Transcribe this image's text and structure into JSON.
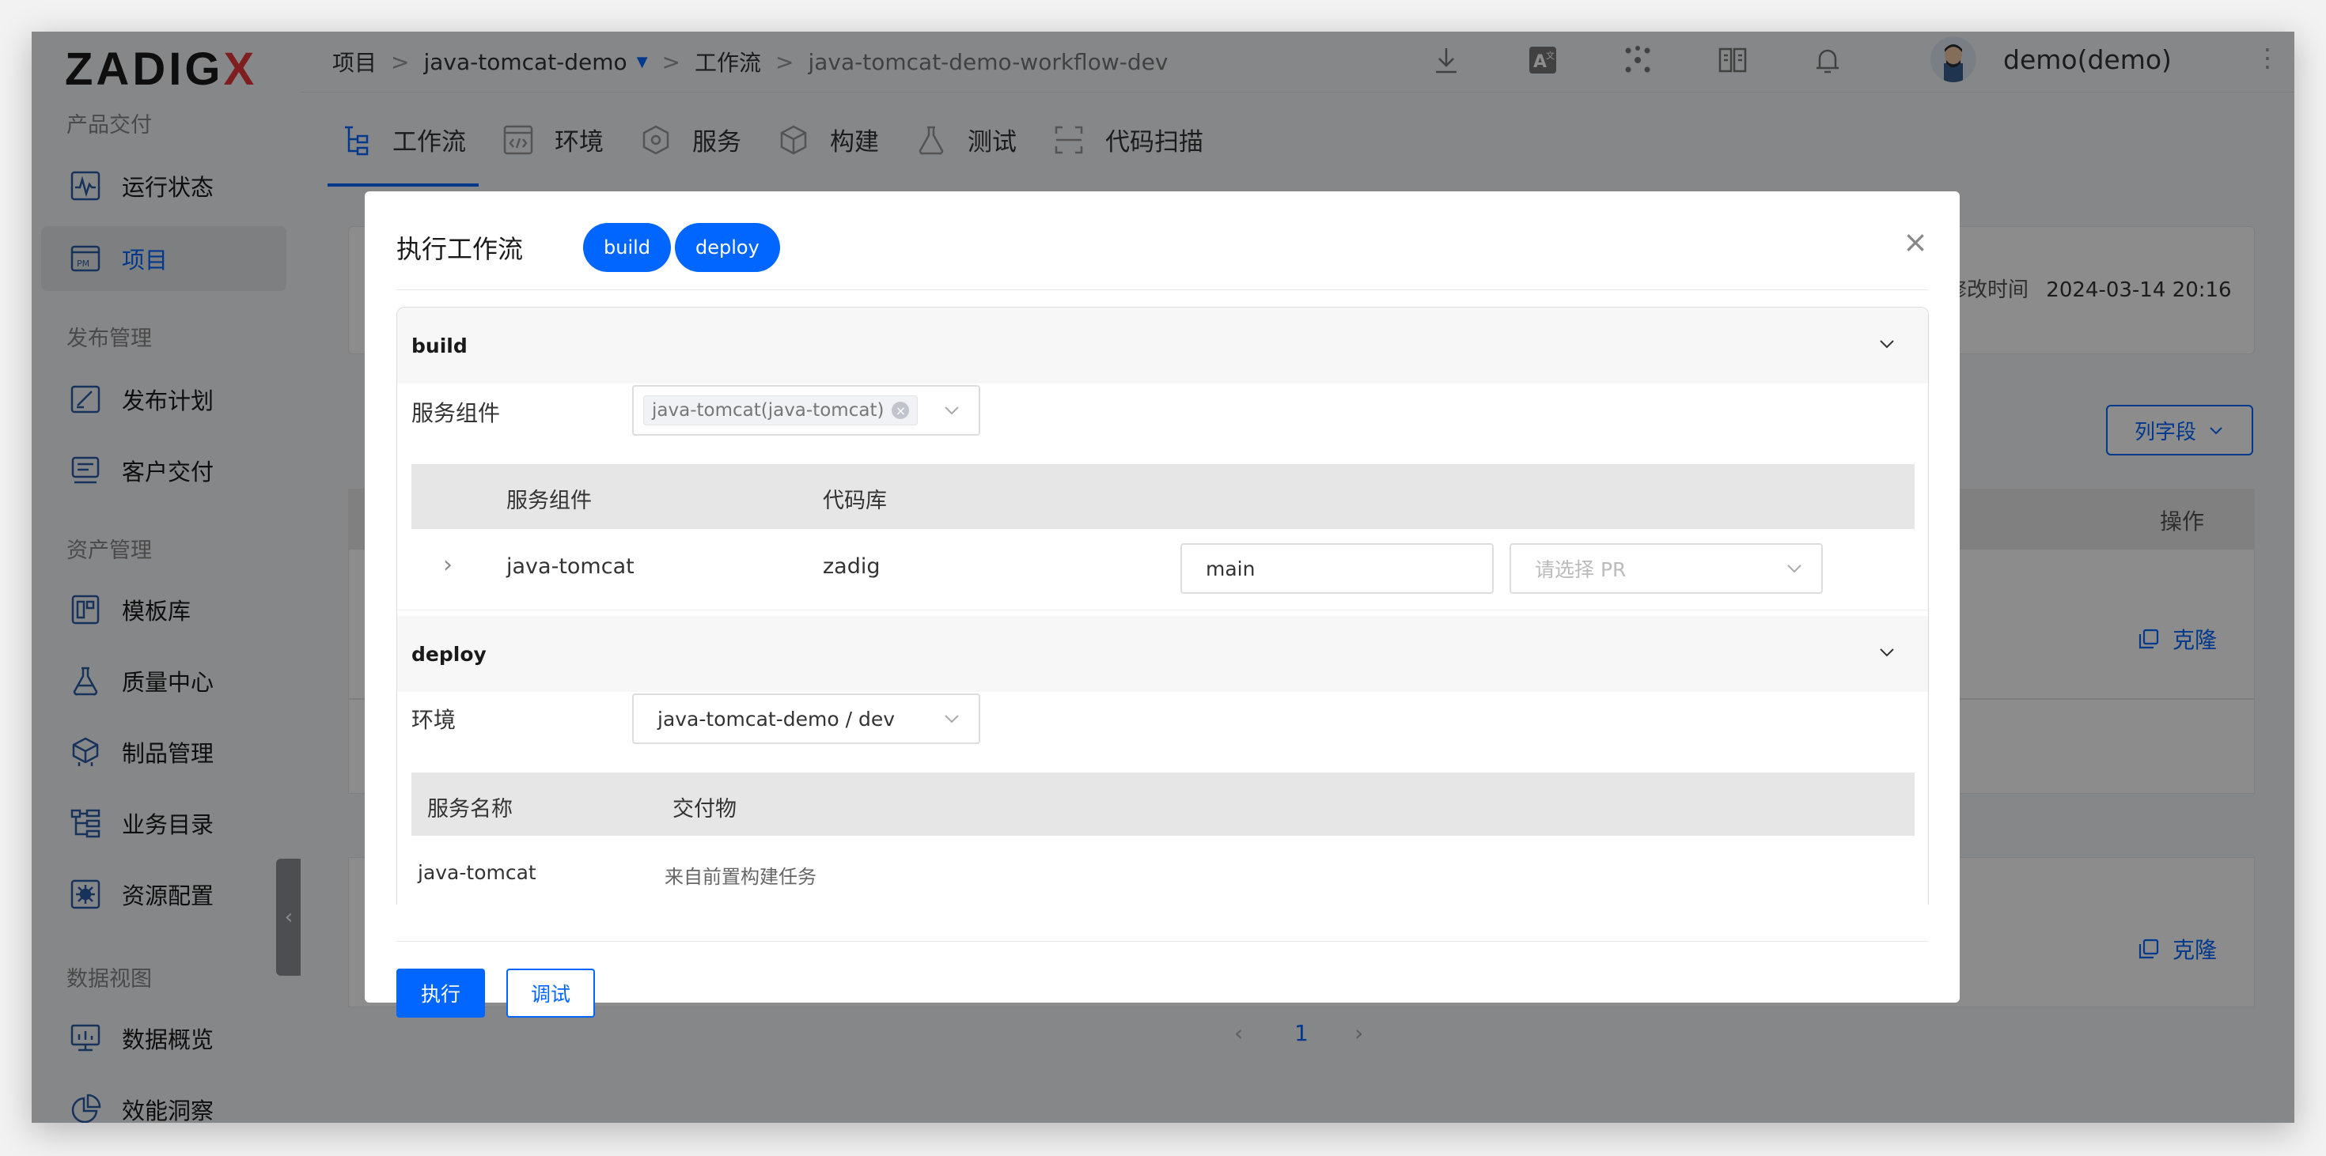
{
  "app": {
    "logo_main": "ZADIG",
    "logo_x": "X"
  },
  "sidebar": {
    "sections": [
      "产品交付",
      "发布管理",
      "资产管理",
      "数据视图"
    ],
    "items": [
      {
        "label": "运行状态",
        "icon": "pulse-icon"
      },
      {
        "label": "项目",
        "icon": "project-icon",
        "active": true
      },
      {
        "label": "发布计划",
        "icon": "plan-icon"
      },
      {
        "label": "客户交付",
        "icon": "delivery-icon"
      },
      {
        "label": "模板库",
        "icon": "template-icon"
      },
      {
        "label": "质量中心",
        "icon": "flask-icon"
      },
      {
        "label": "制品管理",
        "icon": "package-icon"
      },
      {
        "label": "业务目录",
        "icon": "catalog-icon"
      },
      {
        "label": "资源配置",
        "icon": "gear-icon"
      },
      {
        "label": "数据概览",
        "icon": "monitor-icon"
      },
      {
        "label": "效能洞察",
        "icon": "pie-chart-icon"
      }
    ],
    "collapse_glyph": "‹"
  },
  "breadcrumb": {
    "root": "项目",
    "project": "java-tomcat-demo",
    "section": "工作流",
    "current": "java-tomcat-demo-workflow-dev",
    "separator": ">"
  },
  "header": {
    "user": "demo(demo)",
    "more_glyph": "⋮"
  },
  "tabs": [
    {
      "label": "工作流",
      "active": true
    },
    {
      "label": "环境"
    },
    {
      "label": "服务"
    },
    {
      "label": "构建"
    },
    {
      "label": "测试"
    },
    {
      "label": "代码扫描"
    }
  ],
  "background": {
    "modified_label": "修改时间",
    "modified_value": "2024-03-14 20:16",
    "column_button": "列字段",
    "operation_header": "操作",
    "clone_label": "克隆",
    "page_current": "1",
    "page_prev": "‹",
    "page_next": "›"
  },
  "modal": {
    "title": "执行工作流",
    "pills": [
      "build",
      "deploy"
    ],
    "close_glyph": "×",
    "build": {
      "header": "build",
      "field_label": "服务组件",
      "selected_tag": "java-tomcat(java-tomcat)",
      "table_headers": [
        "服务组件",
        "代码库"
      ],
      "row": {
        "expand_glyph": "›",
        "service": "java-tomcat",
        "repo": "zadig",
        "branch": "main",
        "pr_placeholder": "请选择 PR"
      }
    },
    "deploy": {
      "header": "deploy",
      "field_label": "环境",
      "env_value": "java-tomcat-demo / dev",
      "table_headers": [
        "服务名称",
        "交付物"
      ],
      "row": {
        "service": "java-tomcat",
        "artifact": "来自前置构建任务"
      }
    },
    "buttons": {
      "run": "执行",
      "debug": "调试"
    }
  }
}
